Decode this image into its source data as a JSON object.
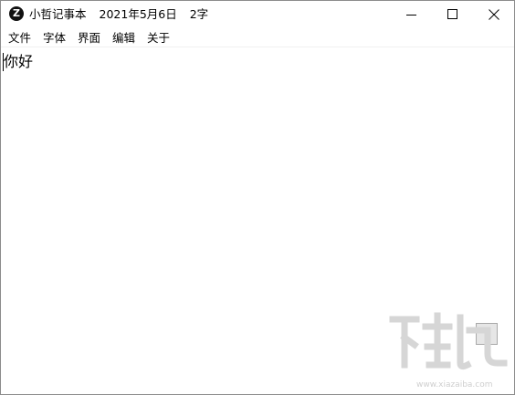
{
  "window": {
    "app_icon_letter": "Z",
    "title": "小哲记事本",
    "date": "2021年5月6日",
    "char_count": "2字"
  },
  "menubar": {
    "items": [
      "文件",
      "字体",
      "界面",
      "编辑",
      "关于"
    ]
  },
  "editor": {
    "content": "你好"
  },
  "float_button": {
    "label": "*"
  },
  "watermark": {
    "text": "下载吧",
    "url_text": "www.xiazaiba.com"
  }
}
